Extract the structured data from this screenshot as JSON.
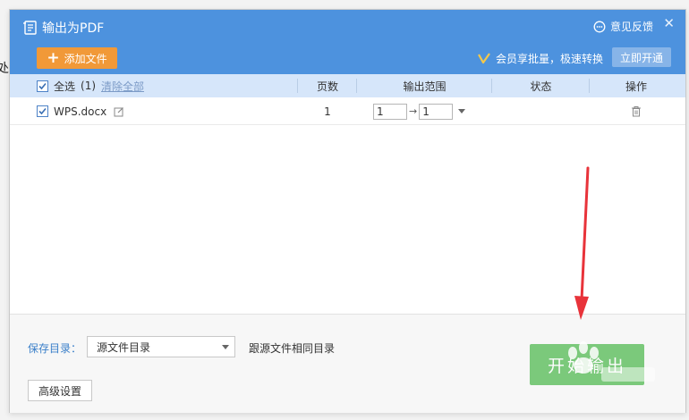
{
  "background": {
    "edge_text": "处"
  },
  "window": {
    "title": "输出为PDF",
    "feedback_label": "意见反馈",
    "close_symbol": "✕"
  },
  "toolbar": {
    "add_file_label": "添加文件",
    "vip_text": "会员享批量，极速转换",
    "open_vip_label": "立即开通"
  },
  "table": {
    "headers": {
      "select_all": "全选",
      "count": "(1)",
      "clear_all": "清除全部",
      "pages": "页数",
      "range": "输出范围",
      "status": "状态",
      "actions": "操作"
    },
    "rows": [
      {
        "filename": "WPS.docx",
        "pages": "1",
        "range_from": "1",
        "range_to": "1",
        "status": ""
      }
    ]
  },
  "footer": {
    "save_dir_label": "保存目录：",
    "save_dir_value": "源文件目录",
    "same_dir_text": "跟源文件相同目录",
    "advanced_label": "高级设置",
    "start_label": "开始输出"
  },
  "colors": {
    "header_blue": "#4d92de",
    "table_header": "#d6e6fa",
    "add_button": "#f19938",
    "start_button": "#4cb84c",
    "annotation_arrow": "#e8333a"
  }
}
